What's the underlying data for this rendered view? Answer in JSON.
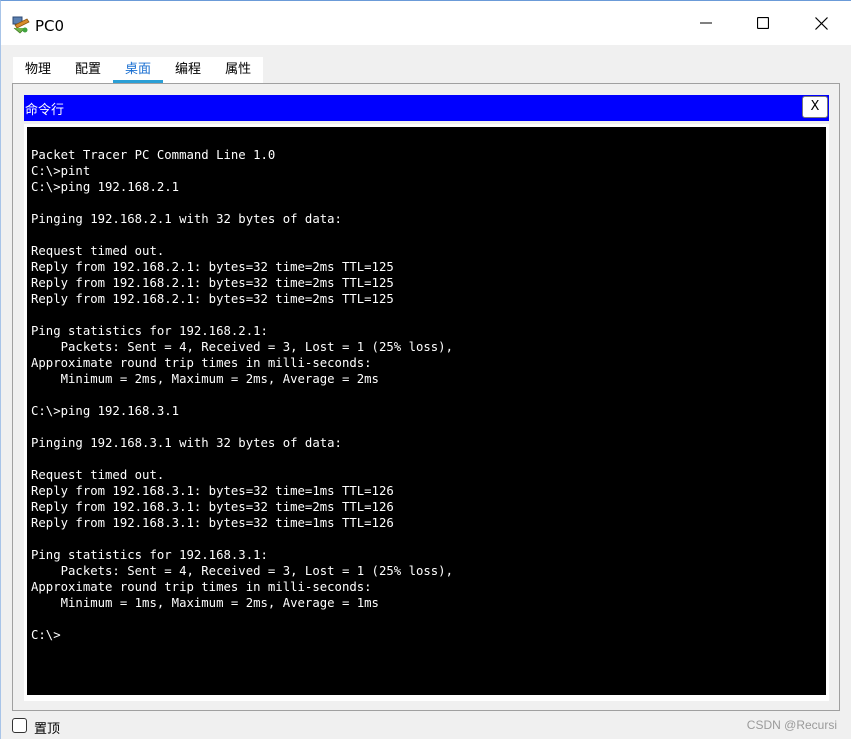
{
  "window": {
    "title": "PC0",
    "app_icon": "packet-tracer-pc-icon",
    "minimize_icon": "minimize-icon",
    "maximize_icon": "maximize-icon",
    "close_icon": "close-icon"
  },
  "tabs": [
    {
      "label": "物理",
      "active": false
    },
    {
      "label": "配置",
      "active": false
    },
    {
      "label": "桌面",
      "active": true
    },
    {
      "label": "编程",
      "active": false
    },
    {
      "label": "属性",
      "active": false
    }
  ],
  "command_prompt": {
    "title": "命令行",
    "close_label": "X",
    "header_color": "#0000ff",
    "output": "Packet Tracer PC Command Line 1.0\nC:\\>pint\nC:\\>ping 192.168.2.1\n\nPinging 192.168.2.1 with 32 bytes of data:\n\nRequest timed out.\nReply from 192.168.2.1: bytes=32 time=2ms TTL=125\nReply from 192.168.2.1: bytes=32 time=2ms TTL=125\nReply from 192.168.2.1: bytes=32 time=2ms TTL=125\n\nPing statistics for 192.168.2.1:\n    Packets: Sent = 4, Received = 3, Lost = 1 (25% loss),\nApproximate round trip times in milli-seconds:\n    Minimum = 2ms, Maximum = 2ms, Average = 2ms\n\nC:\\>ping 192.168.3.1\n\nPinging 192.168.3.1 with 32 bytes of data:\n\nRequest timed out.\nReply from 192.168.3.1: bytes=32 time=1ms TTL=126\nReply from 192.168.3.1: bytes=32 time=2ms TTL=126\nReply from 192.168.3.1: bytes=32 time=1ms TTL=126\n\nPing statistics for 192.168.3.1:\n    Packets: Sent = 4, Received = 3, Lost = 1 (25% loss),\nApproximate round trip times in milli-seconds:\n    Minimum = 1ms, Maximum = 2ms, Average = 1ms\n\nC:\\>"
  },
  "footer": {
    "pin_label": "置顶",
    "pin_checked": false,
    "watermark": "CSDN @Recursi"
  }
}
